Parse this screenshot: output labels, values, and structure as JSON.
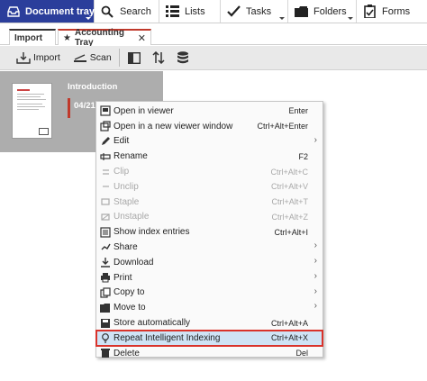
{
  "nav": {
    "items": [
      {
        "label": "Document trays",
        "icon": "inbox-tray-icon"
      },
      {
        "label": "Search",
        "icon": "search-icon"
      },
      {
        "label": "Lists",
        "icon": "list-icon"
      },
      {
        "label": "Tasks",
        "icon": "checkmark-icon"
      },
      {
        "label": "Folders",
        "icon": "folder-icon"
      },
      {
        "label": "Forms",
        "icon": "form-clipboard-icon"
      }
    ],
    "active_color": "#2b3e9b"
  },
  "tabs": [
    {
      "label": "Import"
    },
    {
      "label": "Accounting Tray",
      "star": "★",
      "close": "✕"
    }
  ],
  "toolbar": {
    "import_label": "Import",
    "scan_label": "Scan"
  },
  "document": {
    "title": "Introduction",
    "date": "04/21"
  },
  "context_menu": {
    "items": [
      {
        "label": "Open in viewer",
        "shortcut": "Enter",
        "icon": "viewer-icon"
      },
      {
        "label": "Open in a new viewer window",
        "shortcut": "Ctrl+Alt+Enter",
        "icon": "new-window-icon"
      },
      {
        "label": "Edit",
        "shortcut": "",
        "icon": "edit-pencil-icon",
        "submenu": true
      },
      {
        "label": "Rename",
        "shortcut": "F2",
        "icon": "rename-icon"
      },
      {
        "label": "Clip",
        "shortcut": "Ctrl+Alt+C",
        "icon": "clip-icon",
        "disabled": true
      },
      {
        "label": "Unclip",
        "shortcut": "Ctrl+Alt+V",
        "icon": "unclip-icon",
        "disabled": true
      },
      {
        "label": "Staple",
        "shortcut": "Ctrl+Alt+T",
        "icon": "staple-icon",
        "disabled": true
      },
      {
        "label": "Unstaple",
        "shortcut": "Ctrl+Alt+Z",
        "icon": "unstaple-icon",
        "disabled": true
      },
      {
        "label": "Show index entries",
        "shortcut": "Ctrl+Alt+I",
        "icon": "index-entries-icon"
      },
      {
        "label": "Share",
        "shortcut": "",
        "icon": "share-icon",
        "submenu": true
      },
      {
        "label": "Download",
        "shortcut": "",
        "icon": "download-icon",
        "submenu": true
      },
      {
        "label": "Print",
        "shortcut": "",
        "icon": "printer-icon",
        "submenu": true
      },
      {
        "label": "Copy to",
        "shortcut": "",
        "icon": "copy-icon",
        "submenu": true
      },
      {
        "label": "Move to",
        "shortcut": "",
        "icon": "move-icon",
        "submenu": true
      },
      {
        "label": "Store automatically",
        "shortcut": "Ctrl+Alt+A",
        "icon": "store-icon"
      },
      {
        "label": "Repeat Intelligent Indexing",
        "shortcut": "Ctrl+Alt+X",
        "icon": "lightbulb-icon",
        "highlight": true
      },
      {
        "label": "Delete",
        "shortcut": "Del",
        "icon": "trash-icon"
      }
    ],
    "highlight_color": "#d9332b"
  }
}
